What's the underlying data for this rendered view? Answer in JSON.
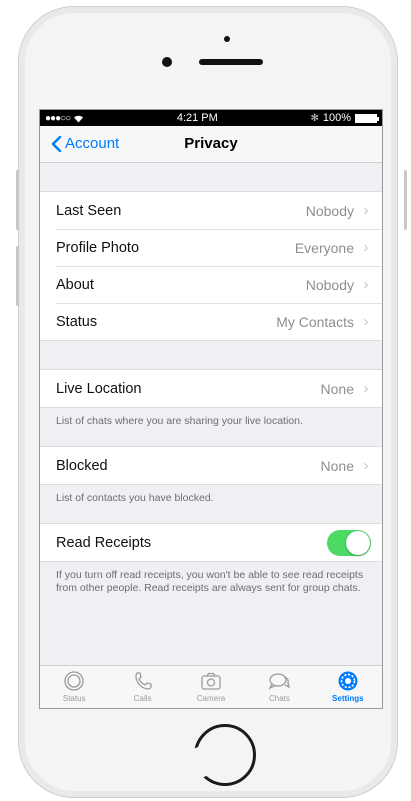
{
  "statusbar": {
    "signal": "●●●○○",
    "time": "4:21 PM",
    "bluetooth": "✻",
    "battery": "100%"
  },
  "nav": {
    "back_label": "Account",
    "title": "Privacy"
  },
  "privacy_rows": [
    {
      "label": "Last Seen",
      "value": "Nobody"
    },
    {
      "label": "Profile Photo",
      "value": "Everyone"
    },
    {
      "label": "About",
      "value": "Nobody"
    },
    {
      "label": "Status",
      "value": "My Contacts"
    }
  ],
  "live_location": {
    "label": "Live Location",
    "value": "None",
    "footnote": "List of chats where you are sharing your live location."
  },
  "blocked": {
    "label": "Blocked",
    "value": "None",
    "footnote": "List of contacts you have blocked."
  },
  "read_receipts": {
    "label": "Read Receipts",
    "enabled": true,
    "footnote": "If you turn off read receipts, you won't be able to see read receipts from other people. Read receipts are always sent for group chats."
  },
  "tabs": [
    {
      "label": "Status",
      "icon": "status-icon"
    },
    {
      "label": "Calls",
      "icon": "phone-icon"
    },
    {
      "label": "Camera",
      "icon": "camera-icon"
    },
    {
      "label": "Chats",
      "icon": "chat-bubbles-icon"
    },
    {
      "label": "Settings",
      "icon": "gear-icon",
      "active": true
    }
  ],
  "colors": {
    "accent": "#007aff",
    "toggle_on": "#4cd964",
    "background": "#efeff4"
  }
}
